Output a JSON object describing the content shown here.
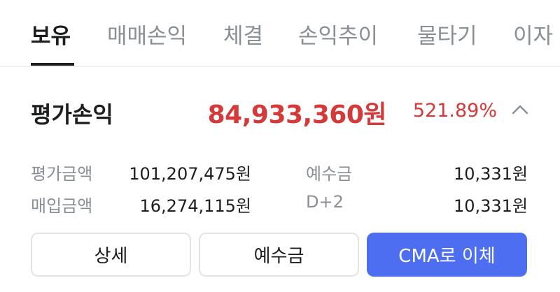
{
  "tabs": [
    {
      "label": "보유",
      "active": true
    },
    {
      "label": "매매손익",
      "active": false
    },
    {
      "label": "체결",
      "active": false
    },
    {
      "label": "손익추이",
      "active": false
    },
    {
      "label": "물타기",
      "active": false
    },
    {
      "label": "이자",
      "active": false
    }
  ],
  "summary": {
    "label": "평가손익",
    "value": "84,933,360원",
    "rate": "521.89%",
    "collapse_icon": "chevron-up-icon"
  },
  "details": {
    "eval_amount_label": "평가금액",
    "eval_amount_value": "101,207,475원",
    "deposit_label": "예수금",
    "deposit_value": "10,331원",
    "purchase_amount_label": "매입금액",
    "purchase_amount_value": "16,274,115원",
    "d2_label": "D+2",
    "d2_value": "10,331원"
  },
  "buttons": {
    "detail": "상세",
    "deposit": "예수금",
    "cma_transfer": "CMA로 이체"
  },
  "colors": {
    "profit_red": "#d43a3a",
    "primary_blue": "#4e6ef2",
    "muted_gray": "#8a8f96",
    "text_dark": "#1b1d1f"
  }
}
